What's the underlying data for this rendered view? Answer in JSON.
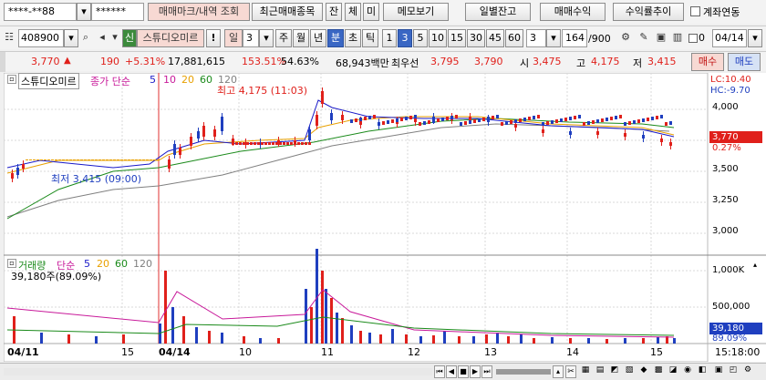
{
  "toolbar1": {
    "account": "****-**88",
    "password": "******",
    "mark_btn": "매매마크/내역 조회",
    "recent_btn": "최근매매종목",
    "jan_btn": "잔",
    "che_btn": "체",
    "mi_btn": "미",
    "memo_btn": "메모보기",
    "daily_btn": "일별잔고",
    "profit_btn": "매매수익",
    "profit_rate_btn": "수익률추이",
    "link_label": "계좌연동"
  },
  "toolbar2": {
    "code": "408900",
    "name_btn": "스튜디오미르",
    "period_btn": "일",
    "period_num": "3",
    "buttons": [
      "주",
      "월",
      "년",
      "분",
      "초",
      "틱",
      "1",
      "3",
      "5",
      "10",
      "15",
      "30",
      "45",
      "60"
    ],
    "interval": "3",
    "count": "164",
    "total": "/900",
    "zero_label": "0",
    "date": "04/14"
  },
  "quote": {
    "price": "3,770",
    "arrow": "▲",
    "change": "190",
    "pct": "+5.31%",
    "volume": "17,881,615",
    "vol_ratio": "153.51%",
    "turnover": "54.63%",
    "amount": "68,943백만",
    "best": "최우선",
    "ask": "3,795",
    "bid": "3,790",
    "open_label": "시",
    "open": "3,475",
    "high_label": "고",
    "high": "4,175",
    "low_label": "저",
    "low": "3,415",
    "buy_btn": "매수",
    "sell_btn": "매도"
  },
  "price_chart": {
    "title": "스튜디오미르",
    "legend_label": "종가 단순",
    "ma": [
      "5",
      "10",
      "20",
      "60",
      "120"
    ],
    "high_note": "최고 4,175 (11:03)",
    "low_note": "최저 3,415 (09:00)",
    "lc": "LC:10.40",
    "hc": "HC:-9.70",
    "cur_price": "3,770",
    "cur_pct": "0.27%",
    "yticks": [
      "4,000",
      "3,750",
      "3,500",
      "3,250",
      "3,000"
    ]
  },
  "volume_chart": {
    "title": "거래량",
    "legend_label": "단순",
    "ma": [
      "5",
      "20",
      "60",
      "120"
    ],
    "cur_vol": "39,180주(89.09%)",
    "yticks": [
      "1,000K",
      "500,000"
    ],
    "cur_val": "39,180",
    "cur_pct": "89.09%"
  },
  "xaxis": {
    "labels": [
      "04/11",
      "15",
      "04/14",
      "10",
      "11",
      "12",
      "13",
      "14",
      "15"
    ],
    "time": "15:18:00"
  },
  "colors": {
    "ma5": "#1a1ac8",
    "ma10": "#c81a9a",
    "ma20": "#e8a000",
    "ma60": "#1a8a1a",
    "ma120": "#808080",
    "up": "#e0201b",
    "down": "#1f3fbf"
  },
  "chart_data": {
    "type": "candlestick",
    "price_range": [
      2900,
      4400
    ],
    "volume_range": [
      0,
      1150000
    ],
    "series": [
      {
        "name": "5",
        "values": []
      },
      {
        "name": "10",
        "values": []
      },
      {
        "name": "20",
        "values": []
      },
      {
        "name": "60",
        "values": []
      },
      {
        "name": "120",
        "values": []
      }
    ]
  }
}
